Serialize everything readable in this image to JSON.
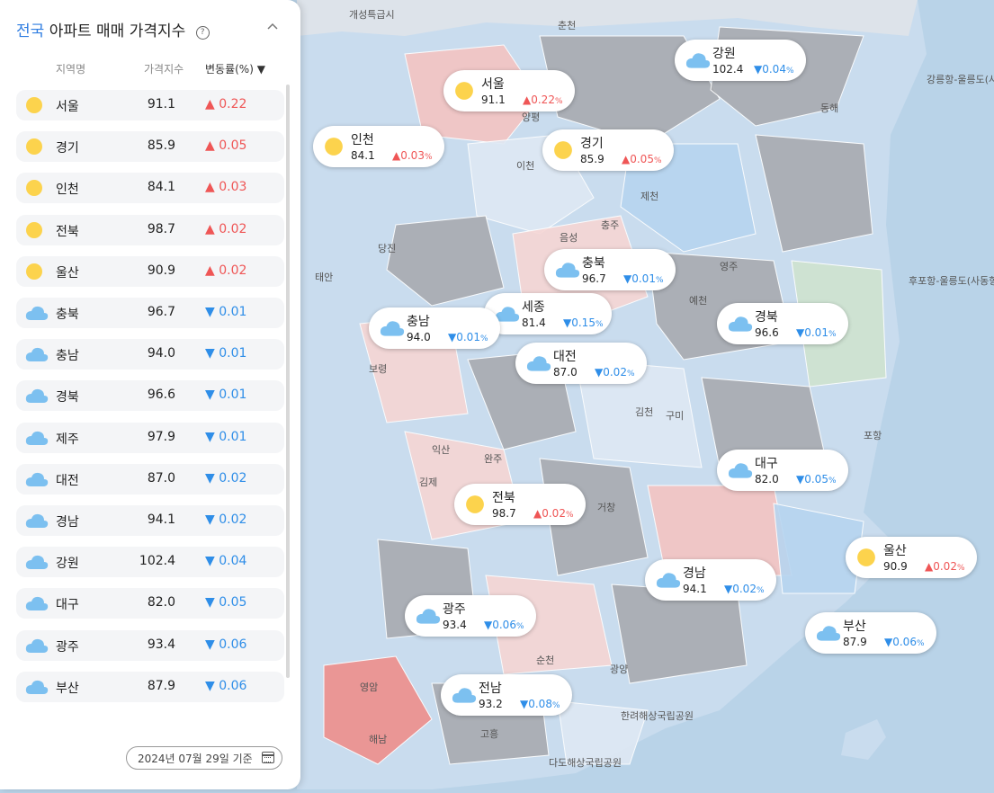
{
  "panel": {
    "title_accent": "전국",
    "title_rest": "아파트 매매 가격지수",
    "help_icon": "?",
    "collapse_icon": "chevron-up",
    "col_region": "지역명",
    "col_index": "가격지수",
    "col_change": "변동률(%) ▼",
    "rows": [
      {
        "name": "서울",
        "value": "91.1",
        "change": "0.22",
        "dir": "up",
        "icon": "sun"
      },
      {
        "name": "경기",
        "value": "85.9",
        "change": "0.05",
        "dir": "up",
        "icon": "sun"
      },
      {
        "name": "인천",
        "value": "84.1",
        "change": "0.03",
        "dir": "up",
        "icon": "sun"
      },
      {
        "name": "전북",
        "value": "98.7",
        "change": "0.02",
        "dir": "up",
        "icon": "sun"
      },
      {
        "name": "울산",
        "value": "90.9",
        "change": "0.02",
        "dir": "up",
        "icon": "sun"
      },
      {
        "name": "충북",
        "value": "96.7",
        "change": "0.01",
        "dir": "down",
        "icon": "cloud"
      },
      {
        "name": "충남",
        "value": "94.0",
        "change": "0.01",
        "dir": "down",
        "icon": "cloud"
      },
      {
        "name": "경북",
        "value": "96.6",
        "change": "0.01",
        "dir": "down",
        "icon": "cloud"
      },
      {
        "name": "제주",
        "value": "97.9",
        "change": "0.01",
        "dir": "down",
        "icon": "cloud"
      },
      {
        "name": "대전",
        "value": "87.0",
        "change": "0.02",
        "dir": "down",
        "icon": "cloud"
      },
      {
        "name": "경남",
        "value": "94.1",
        "change": "0.02",
        "dir": "down",
        "icon": "cloud"
      },
      {
        "name": "강원",
        "value": "102.4",
        "change": "0.04",
        "dir": "down",
        "icon": "cloud"
      },
      {
        "name": "대구",
        "value": "82.0",
        "change": "0.05",
        "dir": "down",
        "icon": "cloud"
      },
      {
        "name": "광주",
        "value": "93.4",
        "change": "0.06",
        "dir": "down",
        "icon": "cloud"
      },
      {
        "name": "부산",
        "value": "87.9",
        "change": "0.06",
        "dir": "down",
        "icon": "cloud"
      }
    ],
    "date_label": "2024년 07월 29일 기준",
    "calendar_icon": "calendar"
  },
  "colors": {
    "up": "#ef5656",
    "down": "#2f8ee8",
    "sun": "#fcd34d",
    "cloud": "#7cc0f0",
    "accent": "#2f7de1"
  },
  "map": {
    "pct_suffix": "%",
    "bubbles": [
      {
        "name": "강원",
        "value": "102.4",
        "change": "0.04",
        "dir": "down",
        "icon": "cloud"
      },
      {
        "name": "서울",
        "value": "91.1",
        "change": "0.22",
        "dir": "up",
        "icon": "sun"
      },
      {
        "name": "인천",
        "value": "84.1",
        "change": "0.03",
        "dir": "up",
        "icon": "sun"
      },
      {
        "name": "경기",
        "value": "85.9",
        "change": "0.05",
        "dir": "up",
        "icon": "sun"
      },
      {
        "name": "충북",
        "value": "96.7",
        "change": "0.01",
        "dir": "down",
        "icon": "cloud"
      },
      {
        "name": "세종",
        "value": "81.4",
        "change": "0.15",
        "dir": "down",
        "icon": "cloud"
      },
      {
        "name": "충남",
        "value": "94.0",
        "change": "0.01",
        "dir": "down",
        "icon": "cloud"
      },
      {
        "name": "경북",
        "value": "96.6",
        "change": "0.01",
        "dir": "down",
        "icon": "cloud"
      },
      {
        "name": "대전",
        "value": "87.0",
        "change": "0.02",
        "dir": "down",
        "icon": "cloud"
      },
      {
        "name": "대구",
        "value": "82.0",
        "change": "0.05",
        "dir": "down",
        "icon": "cloud"
      },
      {
        "name": "전북",
        "value": "98.7",
        "change": "0.02",
        "dir": "up",
        "icon": "sun"
      },
      {
        "name": "울산",
        "value": "90.9",
        "change": "0.02",
        "dir": "up",
        "icon": "sun"
      },
      {
        "name": "경남",
        "value": "94.1",
        "change": "0.02",
        "dir": "down",
        "icon": "cloud"
      },
      {
        "name": "광주",
        "value": "93.4",
        "change": "0.06",
        "dir": "down",
        "icon": "cloud"
      },
      {
        "name": "부산",
        "value": "87.9",
        "change": "0.06",
        "dir": "down",
        "icon": "cloud"
      },
      {
        "name": "전남",
        "value": "93.2",
        "change": "0.08",
        "dir": "down",
        "icon": "cloud"
      }
    ],
    "labels": [
      "개성특급시",
      "춘천",
      "동해",
      "강릉항-울릉도(사동항)",
      "후포항-울릉도(사동항)",
      "포항",
      "영덕",
      "영주",
      "예천",
      "구미",
      "김천",
      "제천",
      "충주",
      "음성",
      "이천",
      "양평",
      "당진",
      "태안",
      "보령",
      "익산",
      "김제",
      "완주",
      "거창",
      "순천",
      "고흥",
      "해남",
      "광양",
      "영암",
      "한려해상국립공원",
      "다도해상국립공원"
    ]
  }
}
